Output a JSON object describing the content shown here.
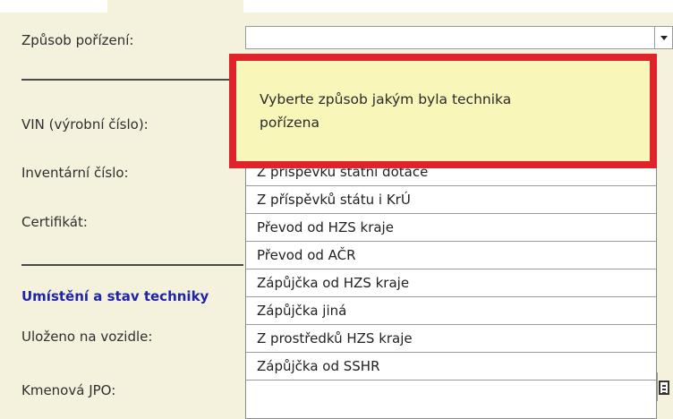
{
  "form": {
    "zpusob_porizeni": "Způsob pořízení:",
    "vin": "VIN (výrobní číslo):",
    "inventarni_cislo": "Inventární číslo:",
    "certifikat": "Certifikát:",
    "section_umisteni": "Umístění a stav techniky",
    "ulozeno": "Uloženo na vozidle:",
    "kmenova": "Kmenová JPO:"
  },
  "tooltip": {
    "line1": "Vyberte způsob jakým byla technika",
    "line2": "pořízena"
  },
  "dropdown": {
    "selected_value": "",
    "options": [
      "Z příspěvku státní dotace",
      "Z příspěvků státu i KrÚ",
      "Převod od HZS kraje",
      "Převod od AČR",
      "Zápůjčka od HZS kraje",
      "Zápůjčka jiná",
      "Z prostředků HZS kraje",
      "Zápůjčka od SSHR"
    ]
  },
  "colors": {
    "background": "#f4f1dc",
    "section_heading": "#1f24a8",
    "highlight_frame": "#e0222b",
    "tooltip_bg": "#f8f6b9"
  },
  "icons": {
    "dropdown": "chevron-down-icon",
    "calendar": "calendar-icon"
  }
}
